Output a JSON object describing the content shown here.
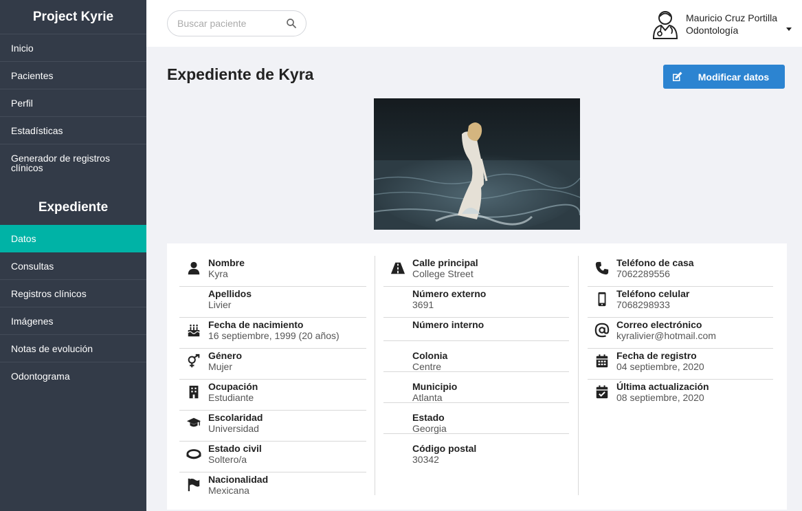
{
  "sidebar": {
    "brand": "Project Kyrie",
    "nav": [
      {
        "label": "Inicio"
      },
      {
        "label": "Pacientes"
      },
      {
        "label": "Perfil"
      },
      {
        "label": "Estadísticas"
      },
      {
        "label": "Generador de registros clínicos"
      }
    ],
    "section_title": "Expediente",
    "section_nav": [
      {
        "label": "Datos"
      },
      {
        "label": "Consultas"
      },
      {
        "label": "Registros clínicos"
      },
      {
        "label": "Imágenes"
      },
      {
        "label": "Notas de evolución"
      },
      {
        "label": "Odontograma"
      }
    ],
    "active_color": "#00b3a6"
  },
  "topbar": {
    "search_placeholder": "Buscar paciente",
    "user_name": "Mauricio Cruz Portilla",
    "user_role": "Odontología"
  },
  "main": {
    "title": "Expediente de Kyra",
    "edit_button": "Modificar datos",
    "button_color": "#2c84d1"
  },
  "fields": {
    "col1": [
      {
        "label": "Nombre",
        "value": "Kyra",
        "icon": "user-icon"
      },
      {
        "label": "Apellidos",
        "value": "Livier",
        "icon": ""
      },
      {
        "label": "Fecha de nacimiento",
        "value": "16 septiembre, 1999 (20 años)",
        "icon": "birthday-cake-icon"
      },
      {
        "label": "Género",
        "value": "Mujer",
        "icon": "gender-icon"
      },
      {
        "label": "Ocupación",
        "value": "Estudiante",
        "icon": "building-icon"
      },
      {
        "label": "Escolaridad",
        "value": "Universidad",
        "icon": "graduation-cap-icon"
      },
      {
        "label": "Estado civil",
        "value": "Soltero/a",
        "icon": "ring-icon"
      },
      {
        "label": "Nacionalidad",
        "value": "Mexicana",
        "icon": "flag-icon"
      }
    ],
    "col2": [
      {
        "label": "Calle principal",
        "value": "College Street",
        "icon": "road-icon"
      },
      {
        "label": "Número externo",
        "value": "3691",
        "icon": ""
      },
      {
        "label": "Número interno",
        "value": "",
        "icon": ""
      },
      {
        "label": "Colonia",
        "value": "Centre",
        "icon": ""
      },
      {
        "label": "Municipio",
        "value": "Atlanta",
        "icon": ""
      },
      {
        "label": "Estado",
        "value": "Georgia",
        "icon": ""
      },
      {
        "label": "Código postal",
        "value": "30342",
        "icon": ""
      }
    ],
    "col3": [
      {
        "label": "Teléfono de casa",
        "value": "7062289556",
        "icon": "phone-icon"
      },
      {
        "label": "Teléfono celular",
        "value": "7068298933",
        "icon": "mobile-icon"
      },
      {
        "label": "Correo electrónico",
        "value": "kyralivier@hotmail.com",
        "icon": "at-icon"
      },
      {
        "label": "Fecha de registro",
        "value": "04 septiembre, 2020",
        "icon": "calendar-icon"
      },
      {
        "label": "Última actualización",
        "value": "08 septiembre, 2020",
        "icon": "calendar-check-icon"
      }
    ]
  }
}
